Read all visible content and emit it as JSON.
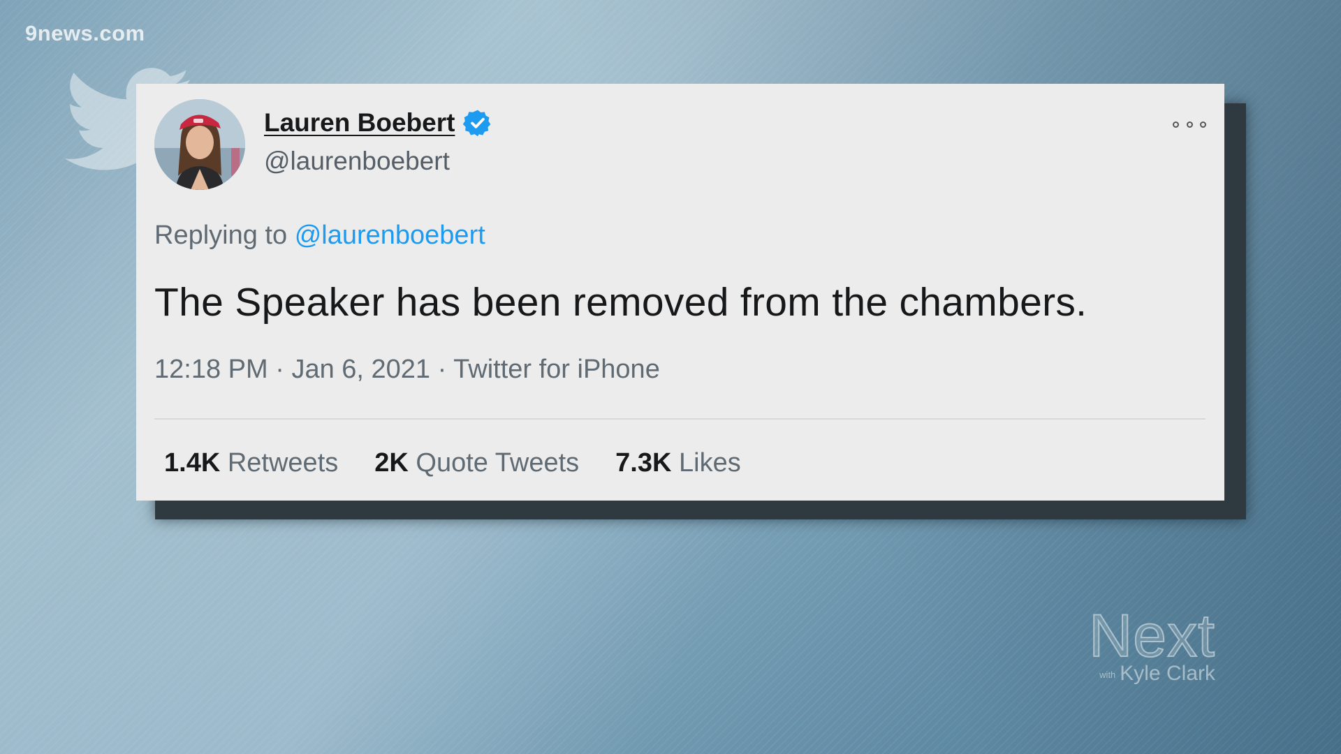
{
  "watermark": "9news.com",
  "tweet": {
    "display_name": "Lauren Boebert",
    "handle": "@laurenboebert",
    "reply_prefix": "Replying to",
    "reply_to": "@laurenboebert",
    "text": "The Speaker has been removed from the chambers.",
    "time": "12:18 PM",
    "separator": "·",
    "date": "Jan 6, 2021",
    "source": "Twitter for iPhone",
    "stats": [
      {
        "num": "1.4K",
        "label": "Retweets"
      },
      {
        "num": "2K",
        "label": "Quote Tweets"
      },
      {
        "num": "7.3K",
        "label": "Likes"
      }
    ]
  },
  "icons": {
    "verified": "verified-badge-icon",
    "more": "more-options-icon",
    "bird": "twitter-bird-icon"
  },
  "colors": {
    "mention": "#1d9bf0",
    "verified": "#1d9bf0",
    "card_bg": "#ececec"
  },
  "show_logo": {
    "main": "Next",
    "with": "with",
    "host": "Kyle Clark"
  }
}
